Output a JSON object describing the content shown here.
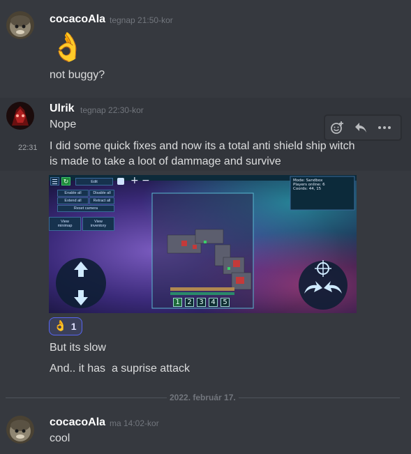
{
  "messages": [
    {
      "user": "cocacoAla",
      "timestamp": "tegnap 21:50-kor",
      "emoji": "👌",
      "text": "not buggy?"
    },
    {
      "user": "Ulrik",
      "timestamp": "tegnap 22:30-kor",
      "text": "Nope",
      "followup_time": "22:31",
      "followup_line1": "I did some quick fixes and now its a total anti shield ship witch",
      "followup_line2": "is made to take a loot of dammage and survive",
      "reaction_emoji": "👌",
      "reaction_count": "1",
      "line3": "But its slow",
      "line4": "And.. it has  a suprise attack"
    },
    {
      "user": "cocacoAla",
      "timestamp": "ma 14:02-kor",
      "text": "cool"
    }
  ],
  "date_divider": "2022. február 17.",
  "game": {
    "edit": "Edit",
    "enable_all": "Enable all",
    "disable_all": "Disable all",
    "extend_all": "Extend all",
    "retract_all": "Retract all",
    "reset_camera": "Reset camera",
    "view_minimap": "View minimap",
    "view_inventory": "View inventory",
    "info_mode": "Mode: Sandbox",
    "info_players": "Players online: 6",
    "info_coords": "Coords: 44, 15",
    "hotbar": [
      "1",
      "2",
      "3",
      "4",
      "5"
    ]
  },
  "colors": {
    "background": "#36393f",
    "hover_background": "#32353b",
    "username": "#ffffff",
    "timestamp": "#72767d",
    "text": "#dcddde",
    "reaction_border": "#5865f2"
  },
  "icons": [
    "add-reaction-icon",
    "reply-icon",
    "more-icon",
    "ok-hand-emoji"
  ]
}
